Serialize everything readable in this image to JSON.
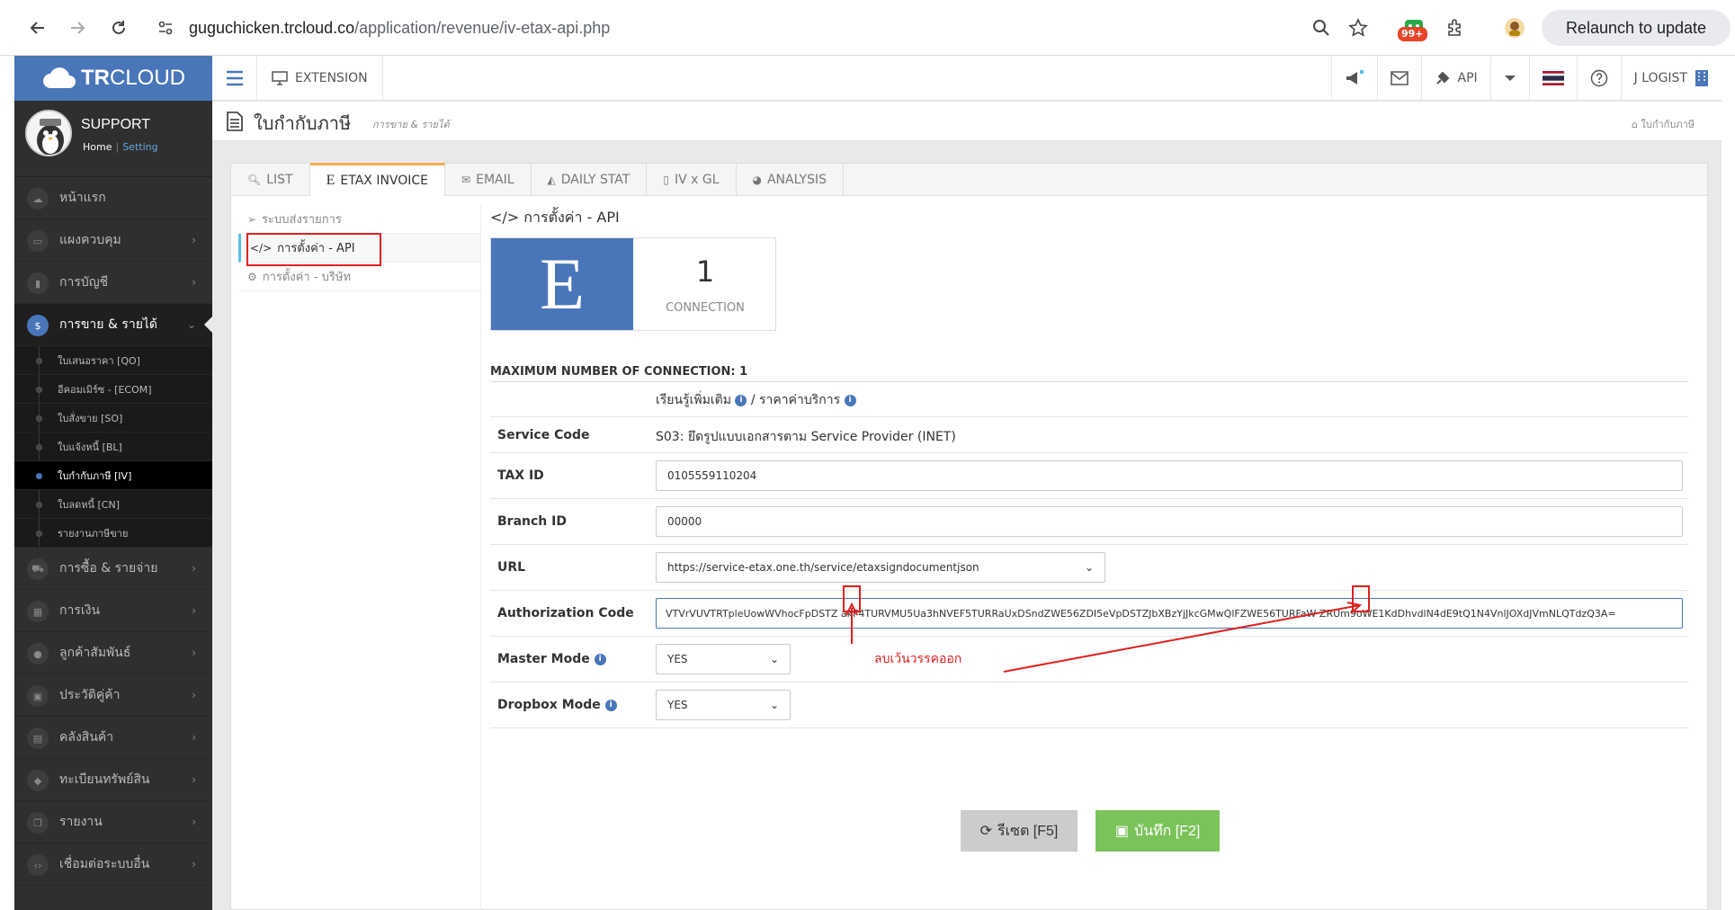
{
  "browser": {
    "url_host": "guguchicken.trcloud.co",
    "url_path": "/application/revenue/iv-etax-api.php",
    "ext_badge": "99+",
    "relaunch_label": "Relaunch to update"
  },
  "app": {
    "logo_bold": "TR",
    "logo_rest": "CLOUD",
    "extension_label": "EXTENSION",
    "api_label": "API",
    "user_label": "J LOGIST"
  },
  "profile": {
    "name": "SUPPORT",
    "home": "Home",
    "separator": "|",
    "setting": "Setting"
  },
  "sidebar": {
    "items": [
      {
        "label": "หน้าแรก",
        "icon": "cloud-icon"
      },
      {
        "label": "แผงควบคุม",
        "icon": "monitor-icon"
      },
      {
        "label": "การบัญชี",
        "icon": "book-icon"
      },
      {
        "label": "การขาย & รายได้",
        "icon": "dollar-icon"
      },
      {
        "label": "การซื้อ & รายจ่าย",
        "icon": "cart-icon"
      },
      {
        "label": "การเงิน",
        "icon": "calendar-icon"
      },
      {
        "label": "ลูกค้าสัมพันธ์",
        "icon": "users-icon"
      },
      {
        "label": "ประวัติคู่ค้า",
        "icon": "contact-icon"
      },
      {
        "label": "คลังสินค้า",
        "icon": "boxes-icon"
      },
      {
        "label": "ทะเบียนทรัพย์สิน",
        "icon": "diamond-icon"
      },
      {
        "label": "รายงาน",
        "icon": "copy-icon"
      },
      {
        "label": "เชื่อมต่อระบบอื่น",
        "icon": "code-icon"
      }
    ],
    "sub": [
      "ใบเสนอราคา [QO]",
      "อีคอมเมิร์ซ - [ECOM]",
      "ใบสั่งขาย [SO]",
      "ใบแจ้งหนี้ [BL]",
      "ใบกำกับภาษี [IV]",
      "ใบลดหนี้ [CN]",
      "รายงานภาษีขาย"
    ]
  },
  "page": {
    "title": "ใบกำกับภาษี",
    "subtitle": "การขาย & รายได้",
    "breadcrumb": "ใบกำกับภาษี"
  },
  "tabs": [
    "LIST",
    "ETAX INVOICE",
    "EMAIL",
    "DAILY STAT",
    "IV x GL",
    "ANALYSIS"
  ],
  "leftnav": [
    "ระบบส่งรายการ",
    "การตั้งค่า - API",
    "การตั้งค่า - บริษัท"
  ],
  "main": {
    "title": "การตั้งค่า - API",
    "e_letter": "E",
    "connection_count": "1",
    "connection_label": "CONNECTION",
    "max_connection": "MAXIMUM NUMBER OF CONNECTION: 1",
    "learn_more": "เรียนรู้เพิ่มเติม",
    "slash": "/",
    "pricing": "ราคาค่าบริการ",
    "service_code_label": "Service Code",
    "service_code_value": "S03: ยึดรูปแบบเอกสารตาม Service Provider (INET)",
    "tax_id_label": "TAX ID",
    "tax_id_value": "0105559110204",
    "branch_id_label": "Branch ID",
    "branch_id_value": "00000",
    "url_label": "URL",
    "url_value": "https://service-etax.one.th/service/etaxsigndocumentjson",
    "auth_label": "Authorization Code",
    "auth_value": "VTVrVUVTRTpleUowWVhocFpDSTZ  akF4TURVMU5Ua3hNVEF5TURRaUxDSndZWE56ZDI5eVpDSTZJbXBzYjJkcGMwQlFZWE56TURFaW  ZRUm9oWE1KdDhvdlN4dE9tQ1N4VnlJOXdJVmNLQTdzQ3A=",
    "master_label": "Master Mode",
    "master_value": "YES",
    "dropbox_label": "Dropbox Mode",
    "dropbox_value": "YES",
    "reset_label": "รีเซต [F5]",
    "save_label": "บันทึก [F2]"
  },
  "annotation": {
    "text": "ลบเว้นวรรคออก",
    "color": "#e02020"
  },
  "colors": {
    "brand": "#4a76b9",
    "save": "#7cc25b",
    "tab_accent": "#f0ad4e"
  }
}
